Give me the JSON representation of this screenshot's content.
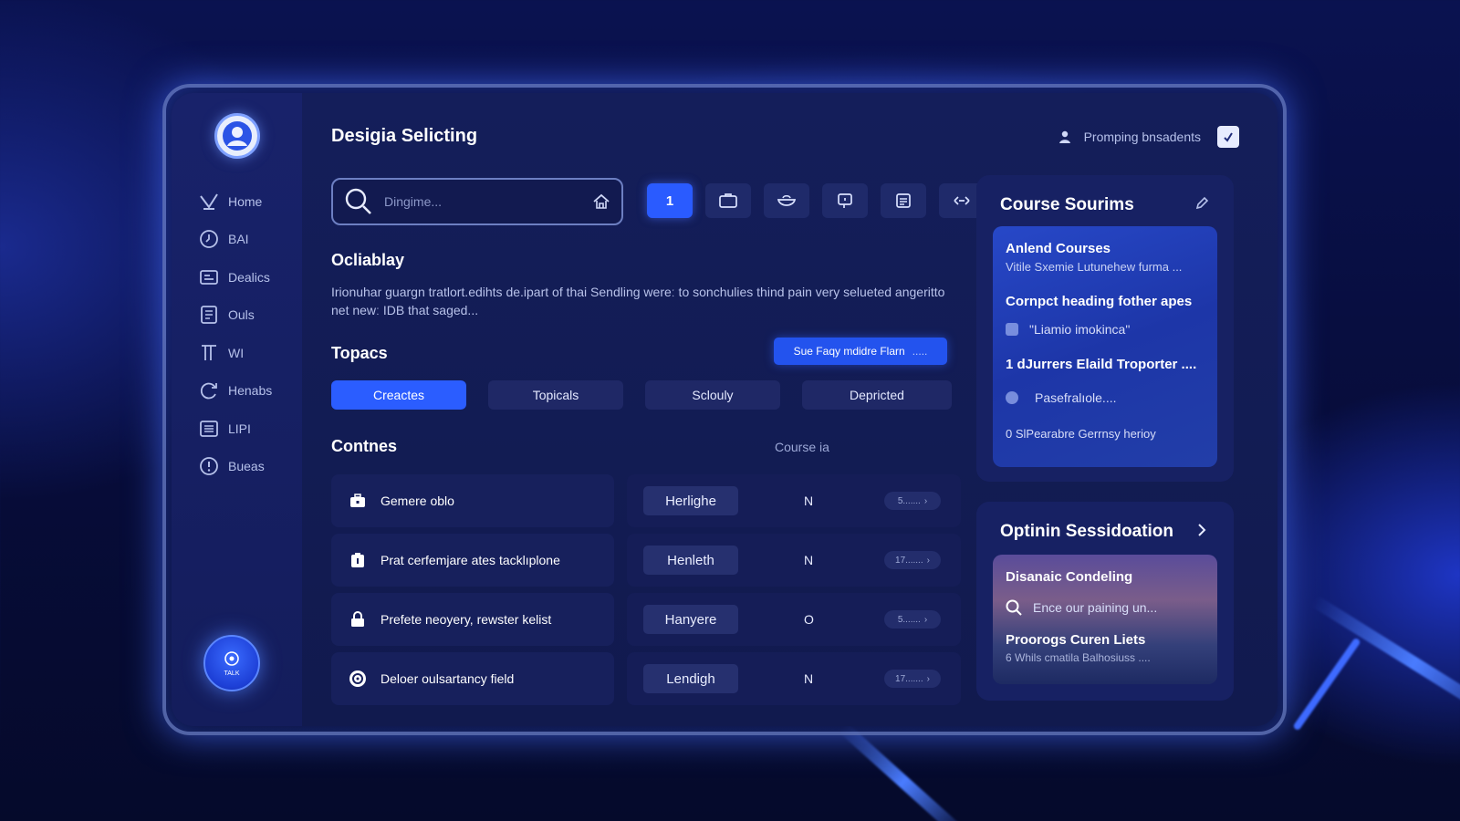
{
  "app": {
    "title": "Desigia Selicting",
    "user_label": "Promping bnsadents"
  },
  "sidebar": {
    "items": [
      {
        "label": "Home",
        "icon": "home-icon"
      },
      {
        "label": "BAI",
        "icon": "clock-icon"
      },
      {
        "label": "Dealics",
        "icon": "dashboard-icon"
      },
      {
        "label": "Ouls",
        "icon": "document-icon"
      },
      {
        "label": "WI",
        "icon": "columns-icon"
      },
      {
        "label": "Henabs",
        "icon": "refresh-icon"
      },
      {
        "label": "LIPI",
        "icon": "list-icon"
      },
      {
        "label": "Bueas",
        "icon": "info-icon"
      }
    ],
    "help_label": "TALK"
  },
  "search": {
    "placeholder": "Dingime..."
  },
  "toolbar": {
    "active_label": "1"
  },
  "overview": {
    "heading": "Ocliablay",
    "text": "Irionuhar guargn tratlort.edihts de.ipart of thai Sendling wereː to sonchulies thind pain very selueted angeritto net newː IDB that saged..."
  },
  "topics": {
    "heading": "Topacs",
    "cta_label": "Sue Faqy mdidre Flarn",
    "cta_dots": ".....",
    "filters": [
      "Creactes",
      "Topicals",
      "Sclouly",
      "Depricted"
    ]
  },
  "content": {
    "heading": "Contnes",
    "column_header": "Course ia",
    "rows": [
      {
        "title": "Gemere oblo",
        "tag": "Herlighe",
        "letter": "N",
        "pill": "5.......",
        "icon": "briefcase-icon"
      },
      {
        "title": "Prat cerfemjare ates tacklıplone",
        "tag": "Henleth",
        "letter": "N",
        "pill": "17.......",
        "icon": "clipboard-icon"
      },
      {
        "title": "Prefete neoyery, rewster kelist",
        "tag": "Hanyere",
        "letter": "O",
        "pill": "5.......",
        "icon": "lock-icon"
      },
      {
        "title": "Deloer oulsartancy field",
        "tag": "Lendigh",
        "letter": "N",
        "pill": "17.......",
        "icon": "gauge-icon"
      }
    ]
  },
  "courses_card": {
    "heading": "Course Sourims",
    "items": [
      {
        "title": "Anlend Courses",
        "sub": "Vitile Sxemie Lutunehew furma ..."
      },
      {
        "title": "Cornpct heading fother apes",
        "sub": "\"Liamio imokinca\""
      },
      {
        "title": "1 dJurrers Elaild Troporter ...."
      },
      {
        "sub": "Pasefralıole...."
      },
      {
        "sub": "0 SlPearabre Gerrnsy herioy"
      }
    ]
  },
  "options_card": {
    "heading": "Optinin Sessidoation",
    "items": [
      {
        "title": "Disanaic Condeling"
      },
      {
        "sub": "Ence our paining un..."
      },
      {
        "title": "Proorogs Curen Liets"
      },
      {
        "sub": "6 Whils cmatila Balhosiuss ...."
      }
    ]
  },
  "colors": {
    "accent": "#2b5dff",
    "panel": "#141e5a",
    "sidebar": "#18226a",
    "text": "#ffffff"
  }
}
